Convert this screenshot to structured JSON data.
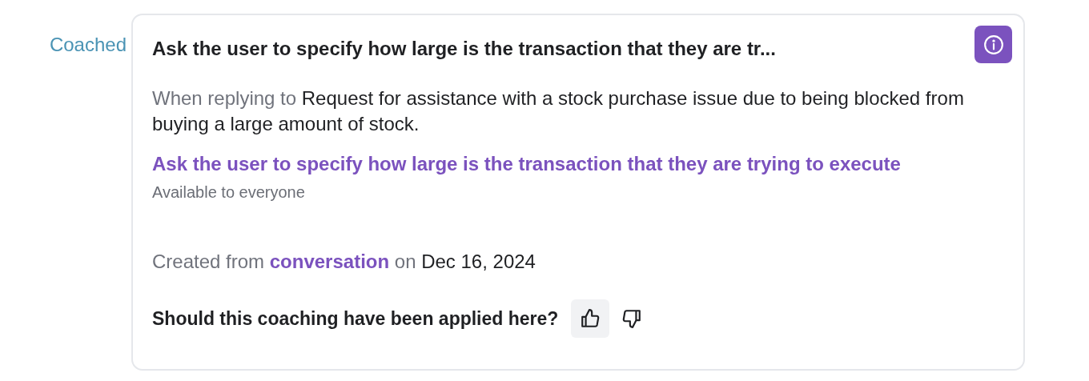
{
  "label": "Coached",
  "card": {
    "title": "Ask the user to specify how large is the transaction that they are tr...",
    "reply_prefix": "When replying to",
    "reply_text": "Request for assistance with a stock purchase issue due to being blocked from buying a large amount of stock.",
    "coaching_link": "Ask the user to specify how large is the transaction that they are trying to execute",
    "availability": "Available to everyone",
    "created": [
      {
        "kind": "muted",
        "text": "Created from"
      },
      {
        "kind": "link",
        "text": "conversation"
      },
      {
        "kind": "muted",
        "text": "on"
      },
      {
        "kind": "plain",
        "text": "Dec 16, 2024"
      }
    ],
    "question": "Should this coaching have been applied here?",
    "feedback": [
      {
        "kind": "up",
        "selected": true
      },
      {
        "kind": "down",
        "selected": false
      }
    ]
  }
}
